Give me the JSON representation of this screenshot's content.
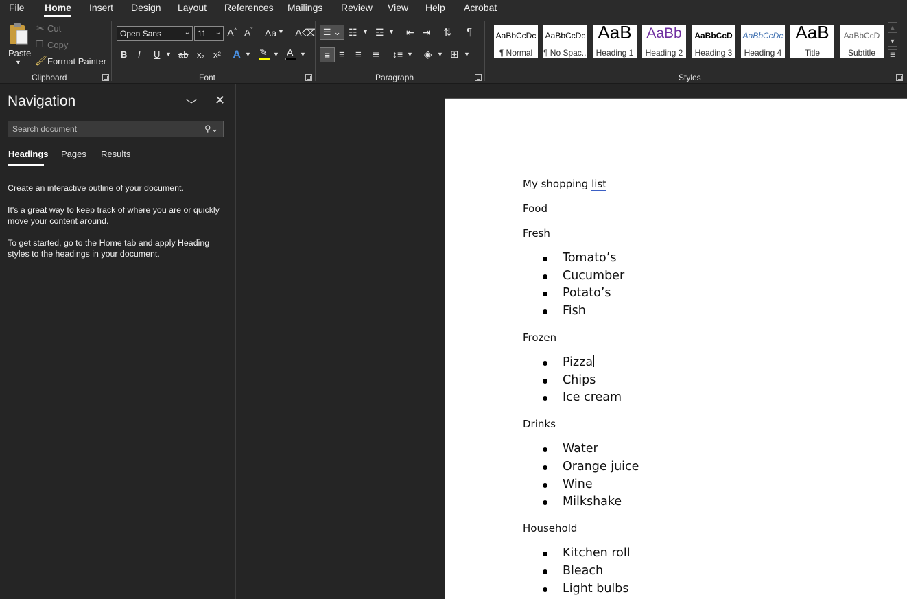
{
  "menu": {
    "tabs": [
      "File",
      "Home",
      "Insert",
      "Design",
      "Layout",
      "References",
      "Mailings",
      "Review",
      "View",
      "Help",
      "Acrobat"
    ],
    "active": "Home"
  },
  "ribbon": {
    "clipboard": {
      "label": "Clipboard",
      "paste": "Paste",
      "cut": "Cut",
      "copy": "Copy",
      "format_painter": "Format Painter"
    },
    "font": {
      "label": "Font",
      "font_name": "Open Sans",
      "font_size": "11",
      "bold": "B",
      "italic": "I",
      "underline": "U",
      "strikethrough": "ab",
      "subscript": "x₂",
      "superscript": "x²",
      "grow": "A^",
      "shrink": "Aˇ",
      "change_case": "Aa"
    },
    "paragraph": {
      "label": "Paragraph",
      "pilcrow": "¶"
    },
    "styles": {
      "label": "Styles",
      "items": [
        {
          "sample": "AaBbCcDc",
          "name": "¶ Normal"
        },
        {
          "sample": "AaBbCcDc",
          "name": "¶ No Spac..."
        },
        {
          "sample": "AaB",
          "name": "Heading 1"
        },
        {
          "sample": "AaBb",
          "name": "Heading 2"
        },
        {
          "sample": "AaBbCcD",
          "name": "Heading 3"
        },
        {
          "sample": "AaBbCcDc",
          "name": "Heading 4"
        },
        {
          "sample": "AaB",
          "name": "Title"
        },
        {
          "sample": "AaBbCcD",
          "name": "Subtitle"
        }
      ]
    }
  },
  "navigation": {
    "title": "Navigation",
    "search_placeholder": "Search document",
    "tabs": [
      "Headings",
      "Pages",
      "Results"
    ],
    "active_tab": "Headings",
    "help": [
      "Create an interactive outline of your document.",
      "It's a great way to keep track of where you are or quickly move your content around.",
      "To get started, go to the Home tab and apply Heading styles to the headings in your document."
    ]
  },
  "document": {
    "title_prefix": "My shopping ",
    "title_link": "list",
    "sections": [
      {
        "heading": "Food",
        "items": []
      },
      {
        "heading": "Fresh",
        "items": [
          "Tomato’s",
          "Cucumber",
          "Potato’s",
          "Fish"
        ]
      },
      {
        "heading": "Frozen",
        "items": [
          "Pizza",
          "Chips",
          "Ice cream"
        ]
      },
      {
        "heading": "Drinks",
        "items": [
          "Water",
          "Orange juice",
          "Wine",
          "Milkshake"
        ]
      },
      {
        "heading": "Household",
        "items": [
          "Kitchen roll",
          "Bleach",
          "Light bulbs"
        ]
      }
    ]
  },
  "colors": {
    "chrome": "#2b2b2b",
    "pane": "#252525",
    "page": "#ffffff",
    "accent_purple": "#7030a0",
    "highlight_yellow": "#ffff00",
    "font_color_red": "#e00000"
  }
}
